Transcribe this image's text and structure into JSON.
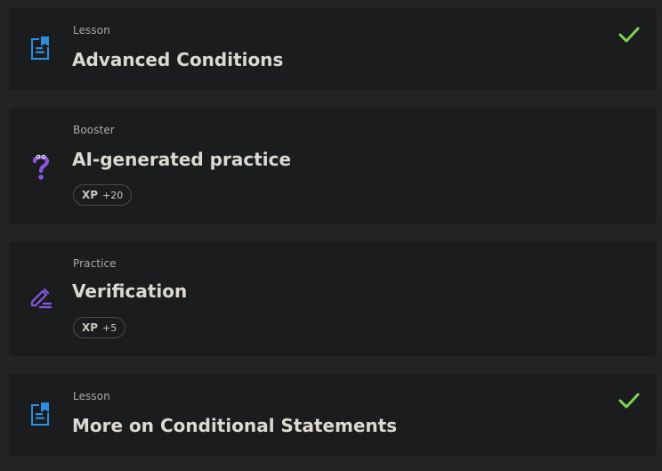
{
  "items": [
    {
      "kind": "Lesson",
      "title": "Advanced Conditions",
      "icon": "document-icon",
      "completed": true
    },
    {
      "kind": "Booster",
      "title": "AI-generated practice",
      "icon": "question-mark-icon",
      "xp_label": "XP",
      "xp_value": "+20"
    },
    {
      "kind": "Practice",
      "title": "Verification",
      "icon": "pencil-icon",
      "xp_label": "XP",
      "xp_value": "+5"
    },
    {
      "kind": "Lesson",
      "title": "More on Conditional Statements",
      "icon": "document-icon",
      "completed": true
    }
  ],
  "colors": {
    "lesson_icon": "#2d8fe0",
    "practice_icon": "#8a56e0",
    "check": "#7fd34e"
  }
}
